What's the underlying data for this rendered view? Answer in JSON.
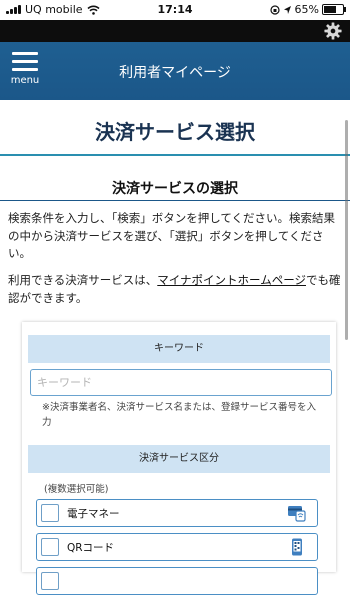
{
  "status_bar": {
    "carrier": "UQ mobile",
    "time": "17:14",
    "battery": "65%"
  },
  "header": {
    "menu_label": "menu",
    "title": "利用者マイページ"
  },
  "page": {
    "title": "決済サービス選択",
    "section_title": "決済サービスの選択",
    "instructions": "検索条件を入力し、「検索」ボタンを押してください。検索結果の中から決済サービスを選び、「選択」ボタンを押してください。",
    "info_prefix": "利用できる決済サービスは、",
    "info_link": "マイナポイントホームページ",
    "info_suffix": "でも確認ができます。"
  },
  "search_form": {
    "keyword_header": "キーワード",
    "keyword_value": "",
    "keyword_placeholder": "キーワード",
    "keyword_hint": "※決済事業者名、決済サービス名または、登録サービス番号を入力",
    "category_header": "決済サービス区分",
    "multi_note": "(複数選択可能)",
    "options": [
      {
        "label": "電子マネー",
        "icon": "emoney-card-icon",
        "checked": false
      },
      {
        "label": "QRコード",
        "icon": "qr-phone-icon",
        "checked": false
      },
      {
        "label": "",
        "icon": "",
        "checked": false
      }
    ]
  },
  "colors": {
    "header_bg": "#1f5f91",
    "accent_divider": "#2a8fb0",
    "band_bg": "#cfe3f3",
    "title_color": "#1a3352"
  }
}
